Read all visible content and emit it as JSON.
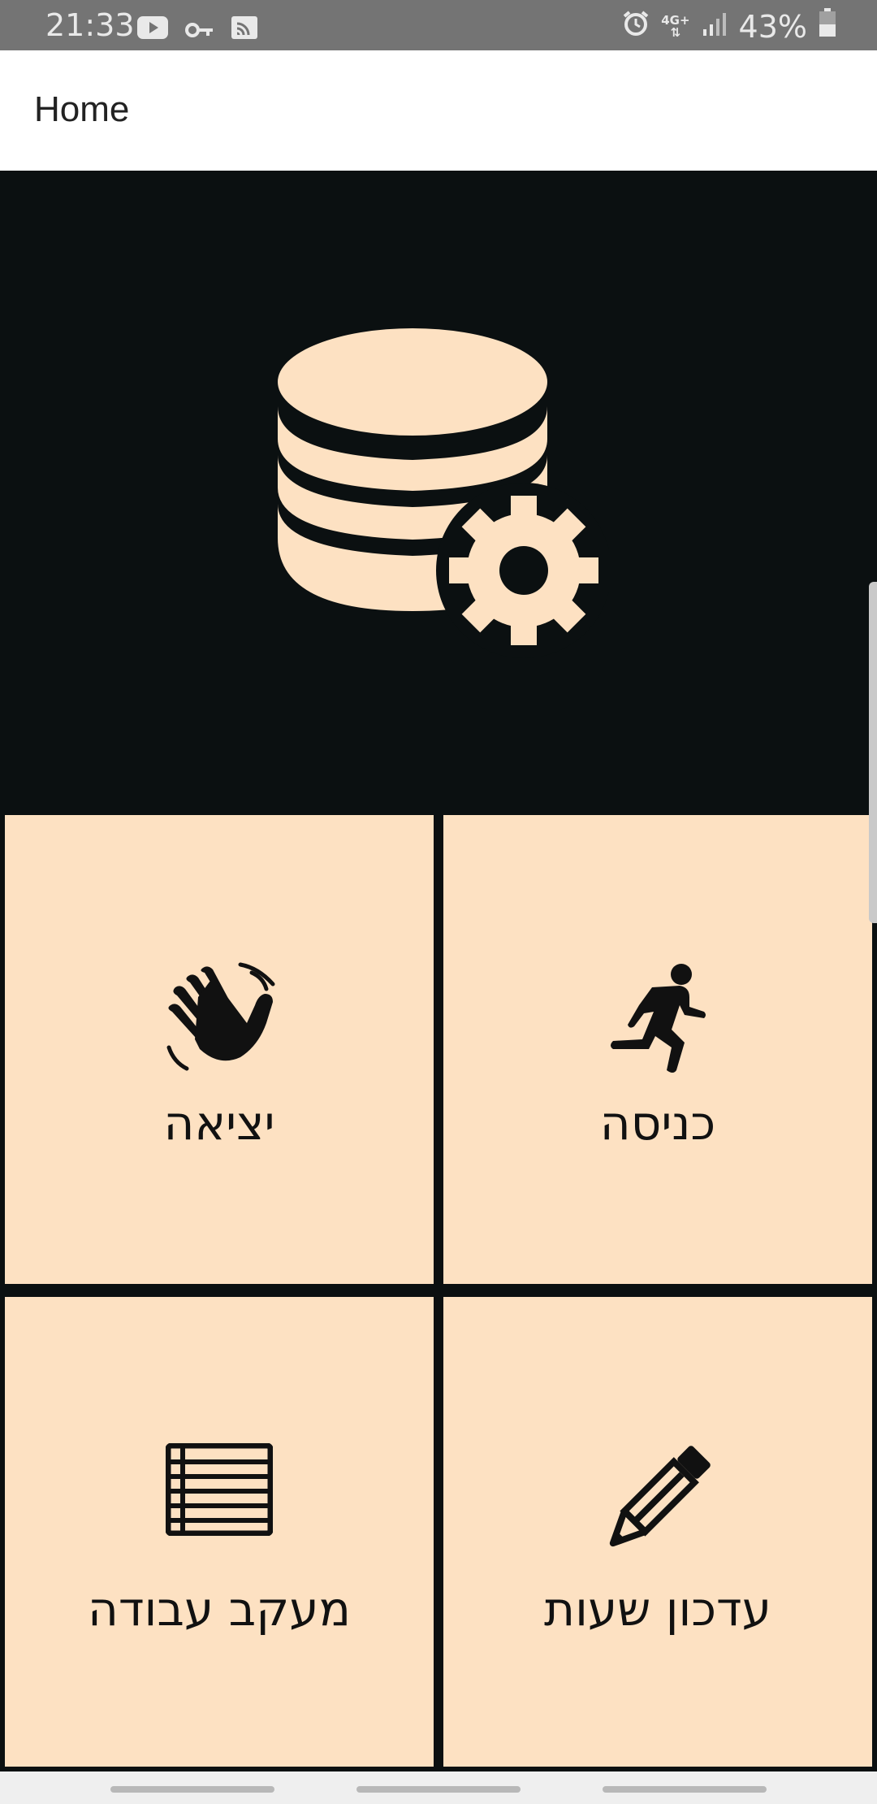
{
  "status_bar": {
    "time": "21:33",
    "battery": "43%",
    "network": "4G+",
    "left_icons": [
      "youtube-icon",
      "key-icon",
      "cast-icon"
    ],
    "right_icons": [
      "alarm-icon",
      "network-icon",
      "signal-icon",
      "battery-icon"
    ]
  },
  "app_bar": {
    "title": "Home"
  },
  "hero": {
    "icon": "database-settings-icon"
  },
  "tiles": [
    {
      "label": "יציאה",
      "icon": "waving-hand-icon"
    },
    {
      "label": "כניסה",
      "icon": "running-person-icon"
    },
    {
      "label": "מעקב עבודה",
      "icon": "list-icon"
    },
    {
      "label": "עדכון שעות",
      "icon": "pencil-icon"
    }
  ],
  "colors": {
    "tile_background": "#fde1c2",
    "hero_background": "#0b1011",
    "icon_accent": "#fde1c2",
    "status_bar": "#747474",
    "app_bar": "#ffffff"
  }
}
